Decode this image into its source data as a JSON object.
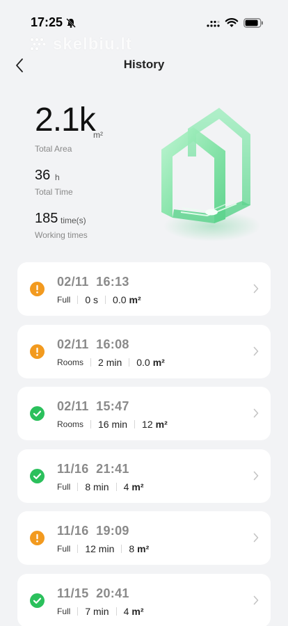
{
  "status_bar": {
    "time": "17:25"
  },
  "watermark": {
    "text": "skelbiu.lt"
  },
  "header": {
    "title": "History"
  },
  "summary": {
    "total_area": {
      "value": "2.1k",
      "unit": "m²",
      "label": "Total Area"
    },
    "total_time": {
      "value": "36",
      "unit": "h",
      "label": "Total Time"
    },
    "working_times": {
      "value": "185",
      "unit": "time(s)",
      "label": "Working times"
    }
  },
  "colors": {
    "warning": "#f29a1f",
    "success": "#2bc05c",
    "house": "#7fe3a4"
  },
  "history": [
    {
      "status": "warning",
      "datetime": "02/11  16:13",
      "mode": "Full",
      "duration": "0 s",
      "area": "0.0",
      "area_unit": "m²"
    },
    {
      "status": "warning",
      "datetime": "02/11  16:08",
      "mode": "Rooms",
      "duration": "2 min",
      "area": "0.0",
      "area_unit": "m²"
    },
    {
      "status": "success",
      "datetime": "02/11  15:47",
      "mode": "Rooms",
      "duration": "16 min",
      "area": "12",
      "area_unit": "m²"
    },
    {
      "status": "success",
      "datetime": "11/16  21:41",
      "mode": "Full",
      "duration": "8 min",
      "area": "4",
      "area_unit": "m²"
    },
    {
      "status": "warning",
      "datetime": "11/16  19:09",
      "mode": "Full",
      "duration": "12 min",
      "area": "8",
      "area_unit": "m²"
    },
    {
      "status": "success",
      "datetime": "11/15  20:41",
      "mode": "Full",
      "duration": "7 min",
      "area": "4",
      "area_unit": "m²"
    }
  ]
}
